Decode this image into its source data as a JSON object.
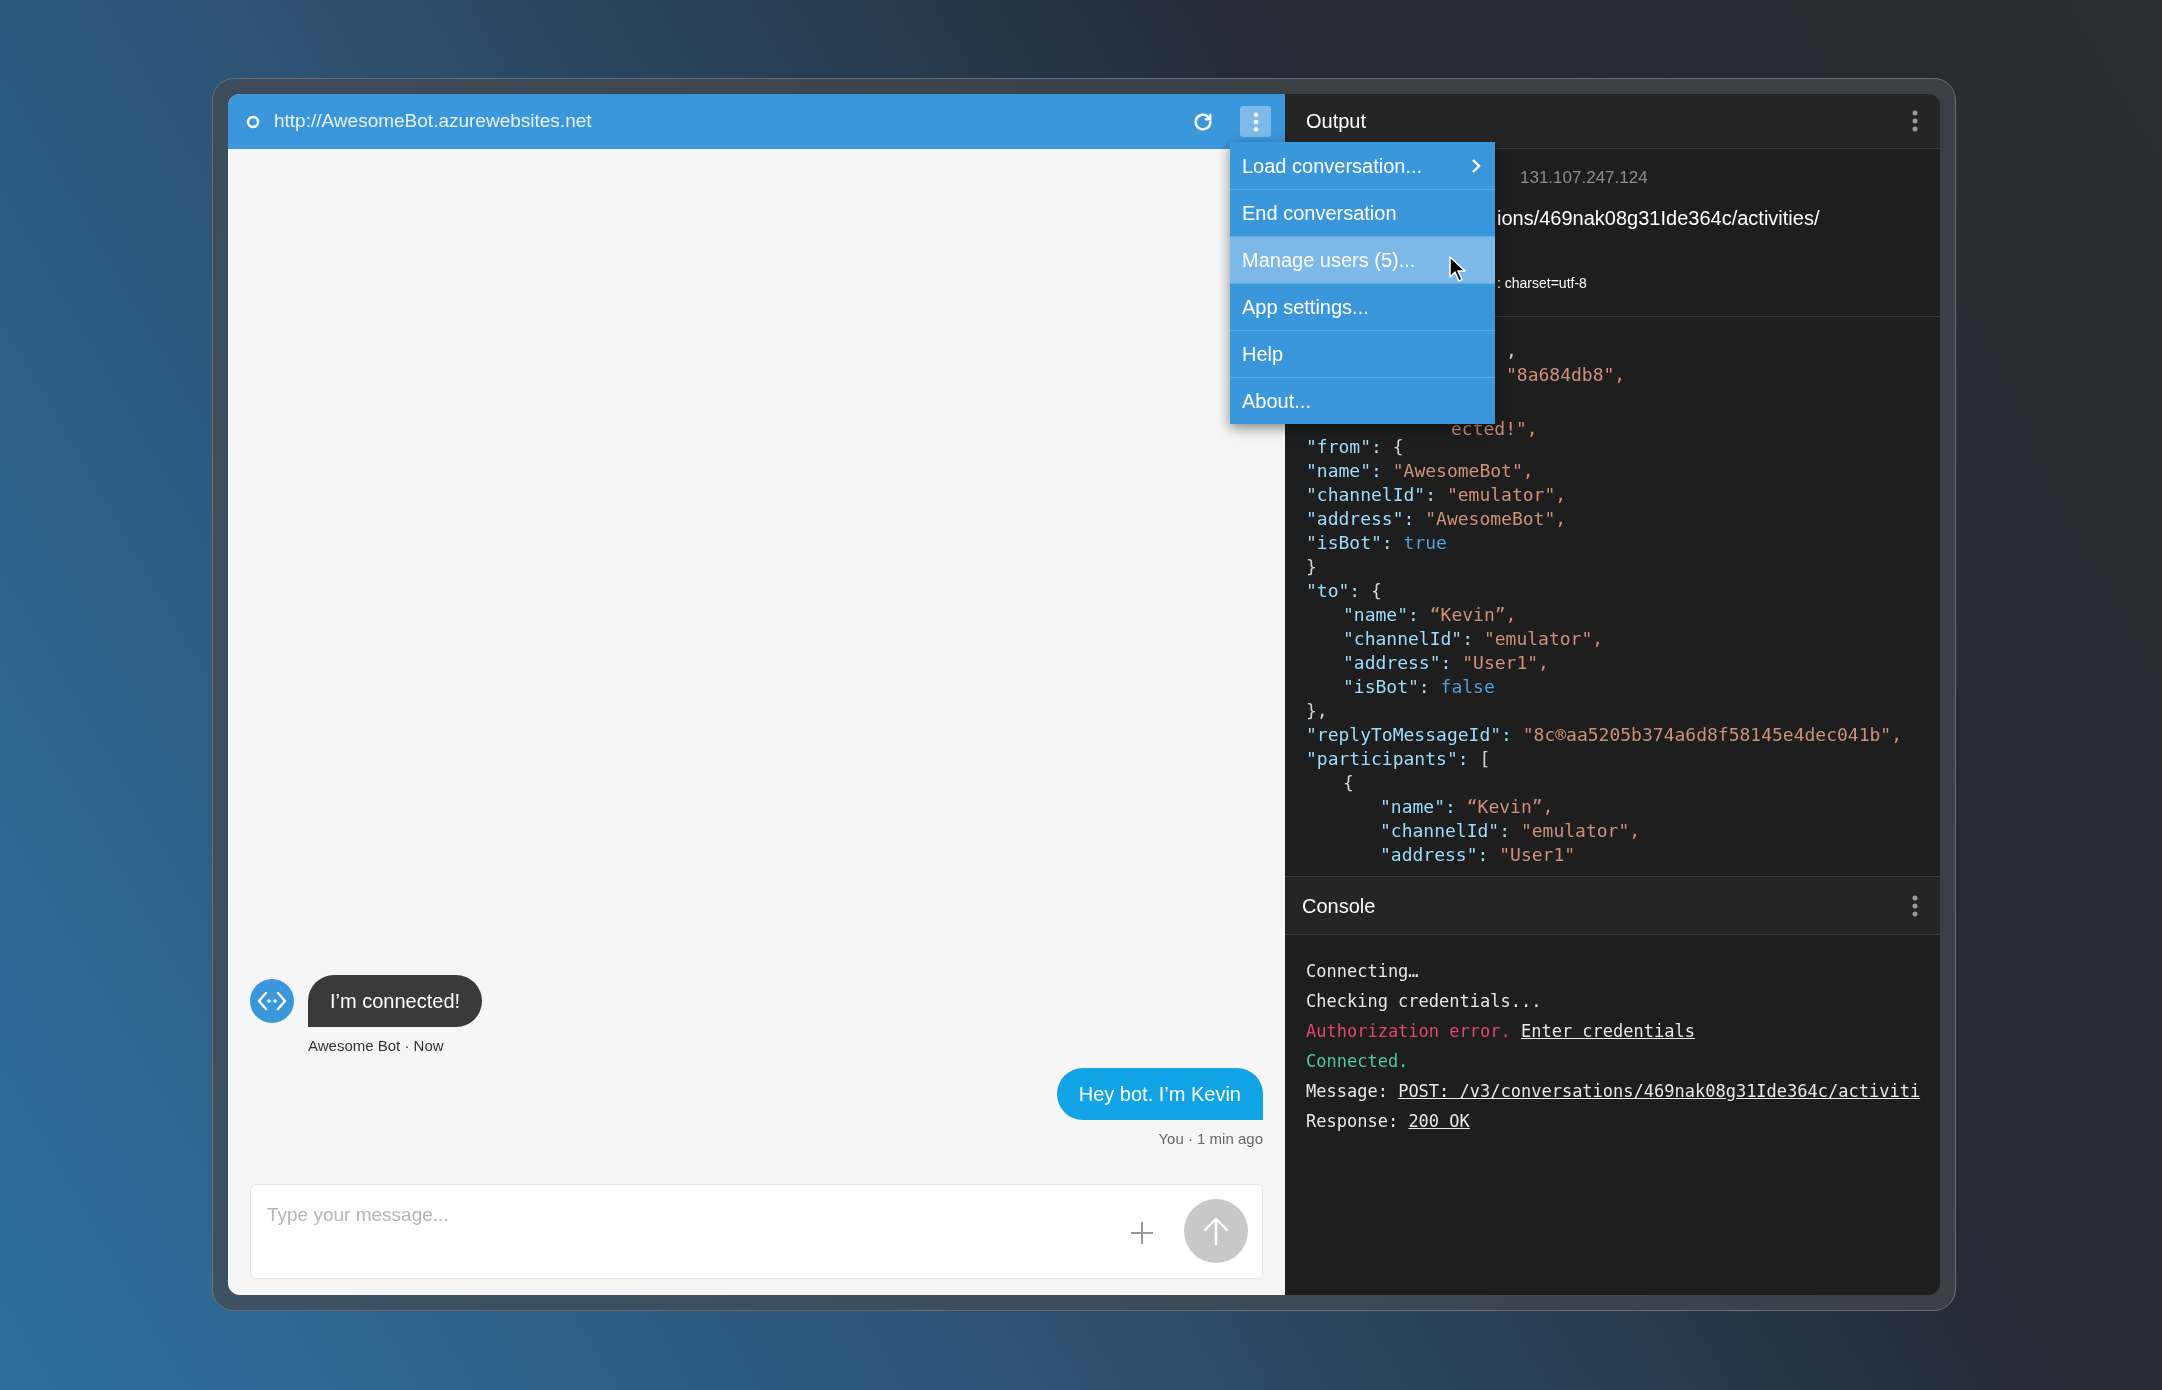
{
  "address_bar": {
    "url": "http://AwesomeBot.azurewebsites.net",
    "menu_expanded": true
  },
  "menu": [
    {
      "label": "Load conversation...",
      "has_submenu": true,
      "highlighted": false
    },
    {
      "label": "End conversation",
      "has_submenu": false,
      "highlighted": false
    },
    {
      "label": "Manage users (5)...",
      "has_submenu": false,
      "highlighted": true
    },
    {
      "label": "App settings...",
      "has_submenu": false,
      "highlighted": false
    },
    {
      "label": "Help",
      "has_submenu": false,
      "highlighted": false
    },
    {
      "label": "About...",
      "has_submenu": false,
      "highlighted": false
    }
  ],
  "chat": {
    "messages": [
      {
        "kind": "bot",
        "text": "I’m connected!",
        "meta": "Awesome Bot · Now"
      },
      {
        "kind": "user",
        "text": "Hey bot. I’m Kevin",
        "meta": "You · 1 min ago"
      }
    ],
    "input": {
      "placeholder": "Type your message..."
    }
  },
  "output": {
    "title": "Output",
    "meta": [
      {
        "kind": "ip",
        "text": "131.107.247.124"
      },
      {
        "kind": "url",
        "text": "ions/469nak08g31Ide364c/activities/"
      },
      {
        "kind": "header",
        "text": ": charset=utf-8"
      }
    ],
    "fragments": [
      {
        "value": ",",
        "kind": "punct"
      },
      {
        "value": "\"8a684db8\",",
        "kind": "string"
      }
    ],
    "lines": [
      {
        "value": "ected!\",",
        "kind": "string",
        "cut": true
      },
      {
        "key": "\"from\":",
        "value": "{",
        "kind": "punct"
      },
      {
        "key": "\"name\":",
        "value": "\"AwesomeBot\",",
        "kind": "string"
      },
      {
        "key": "\"channelId\":",
        "value": "\"emulator\",",
        "kind": "string"
      },
      {
        "key": "\"address\":",
        "value": "\"AwesomeBot\",",
        "kind": "string"
      },
      {
        "key": "\"isBot\":",
        "value": "true",
        "kind": "boolean"
      },
      {
        "value": "}",
        "kind": "punct"
      },
      {
        "key": "\"to\":",
        "value": "{",
        "kind": "punct",
        "children": [
          {
            "key": "\"name\":",
            "value": "“Kevin”,",
            "kind": "string"
          },
          {
            "key": "\"channelId\":",
            "value": "\"emulator\",",
            "kind": "string"
          },
          {
            "key": "\"address\":",
            "value": "\"User1\",",
            "kind": "string"
          },
          {
            "key": "\"isBot\":",
            "value": "false",
            "kind": "boolean"
          }
        ]
      },
      {
        "value": "},",
        "kind": "punct"
      },
      {
        "key": "\"replyToMessageId\":",
        "value": "\"8c®aa5205b374a6d8f58145e4dec041b\",",
        "kind": "string"
      },
      {
        "key": "\"participants\":",
        "value": "[",
        "kind": "punct",
        "children": [
          {
            "value": "{",
            "kind": "punct",
            "children": [
              {
                "key": "\"name\":",
                "value": "“Kevin”,",
                "kind": "string"
              },
              {
                "key": "\"channelId\":",
                "value": "\"emulator\",",
                "kind": "string"
              },
              {
                "key": "\"address\":",
                "value": "\"User1\"",
                "kind": "string"
              }
            ]
          }
        ]
      }
    ]
  },
  "console": {
    "title": "Console",
    "lines": [
      {
        "kind": "plain",
        "text": "Connecting…"
      },
      {
        "kind": "plain",
        "text": "Checking credentials..."
      },
      {
        "kind": "error",
        "text": "Authorization error.",
        "link": "Enter credentials"
      },
      {
        "kind": "success",
        "text": "Connected."
      },
      {
        "kind": "plain",
        "text": "Message:",
        "link": "POST: /v3/conversations/469nak08g31Ide364c/activiti"
      },
      {
        "kind": "plain",
        "text": "Response:",
        "link": "200 OK"
      }
    ]
  }
}
